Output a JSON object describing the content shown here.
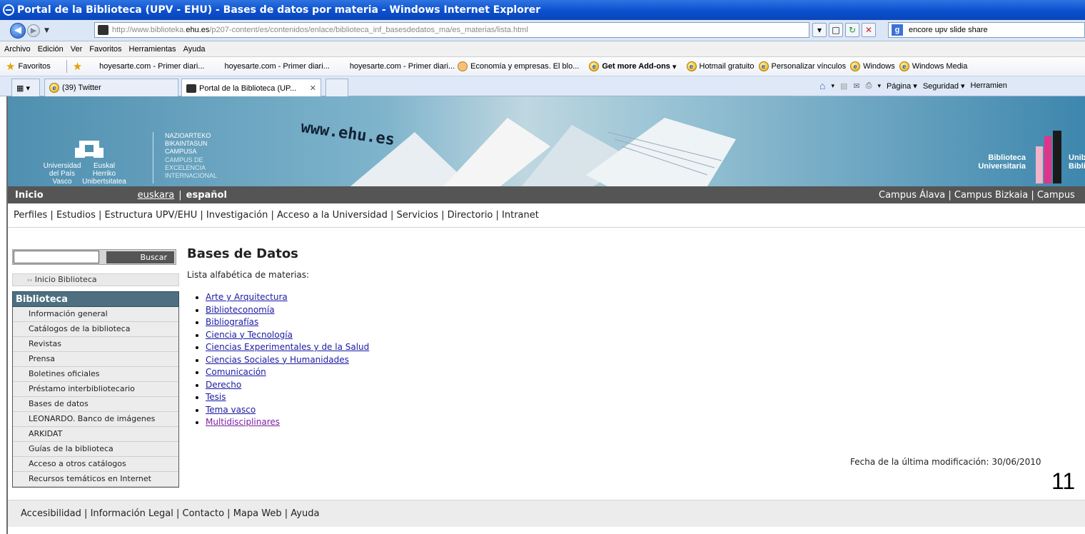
{
  "window": {
    "title": "Portal de la Biblioteca (UPV - EHU) - Bases de datos por materia - Windows Internet Explorer"
  },
  "address": {
    "url_prefix": "http://www.biblioteka.",
    "url_domain": "ehu.es",
    "url_path": "/p207-content/es/contenidos/enlace/biblioteca_inf_basesdedatos_ma/es_materias/lista.html",
    "search_value": "encore upv slide share"
  },
  "menu": [
    "Archivo",
    "Edición",
    "Ver",
    "Favoritos",
    "Herramientas",
    "Ayuda"
  ],
  "favorites": {
    "label": "Favoritos",
    "items": [
      "hoyesarte.com - Primer diari...",
      "hoyesarte.com - Primer diari...",
      "hoyesarte.com - Primer diari...",
      "Economía y empresas. El blo...",
      "Get more Add-ons",
      "Hotmail gratuito",
      "Personalizar vínculos",
      "Windows",
      "Windows Media"
    ]
  },
  "tabs": [
    {
      "label": "(39) Twitter"
    },
    {
      "label": "Portal de la Biblioteca (UP..."
    }
  ],
  "tab_tools": {
    "page": "Página",
    "security": "Seguridad",
    "tools": "Herramien"
  },
  "banner": {
    "www_text": "www.ehu.es",
    "uni_es": "Universidad del País Vasco",
    "uni_eu": "Euskal Herriko Unibertsitatea",
    "campus_eu": "NAZIOARTEKO BIKAINTASUN CAMPUSA",
    "campus_es": "CAMPUS DE EXCELENCIA INTERNACIONAL",
    "bib_es": "Biblioteca Universitaria",
    "bib_eu": "Unib Bibli"
  },
  "nav": {
    "inicio": "Inicio",
    "lang_eu": "euskara",
    "lang_es": "español",
    "campus": [
      "Campus Álava",
      "Campus Bizkaia",
      "Campus"
    ]
  },
  "links": [
    "Perfiles",
    "Estudios",
    "Estructura UPV/EHU",
    "Investigación",
    "Acceso a la Universidad",
    "Servicios",
    "Directorio",
    "Intranet"
  ],
  "search": {
    "button": "Buscar",
    "value": ""
  },
  "sidebar": {
    "home": "Inicio Biblioteca",
    "heading": "Biblioteca",
    "items": [
      "Información general",
      "Catálogos de la biblioteca",
      "Revistas",
      "Prensa",
      "Boletines oficiales",
      "Préstamo interbibliotecario",
      "Bases de datos",
      "LEONARDO. Banco de imágenes",
      "ARKIDAT",
      "Guías de la biblioteca",
      "Acceso a otros catálogos",
      "Recursos temáticos en Internet"
    ]
  },
  "main": {
    "title": "Bases de Datos",
    "subtitle": "Lista alfabética de materias:",
    "subjects": [
      "Arte y Arquitectura",
      "Biblioteconomía",
      "Bibliografías",
      "Ciencia y Tecnología",
      "Ciencias Experimentales y de la Salud",
      "Ciencias Sociales y Humanidades",
      "Comunicación",
      "Derecho",
      "Tesis",
      "Tema vasco",
      "Multidisciplinares"
    ],
    "modified": "Fecha de la última modificación: 30/06/2010",
    "page_number": "11"
  },
  "footer": [
    "Accesibilidad",
    "Información Legal",
    "Contacto",
    "Mapa Web",
    "Ayuda"
  ]
}
